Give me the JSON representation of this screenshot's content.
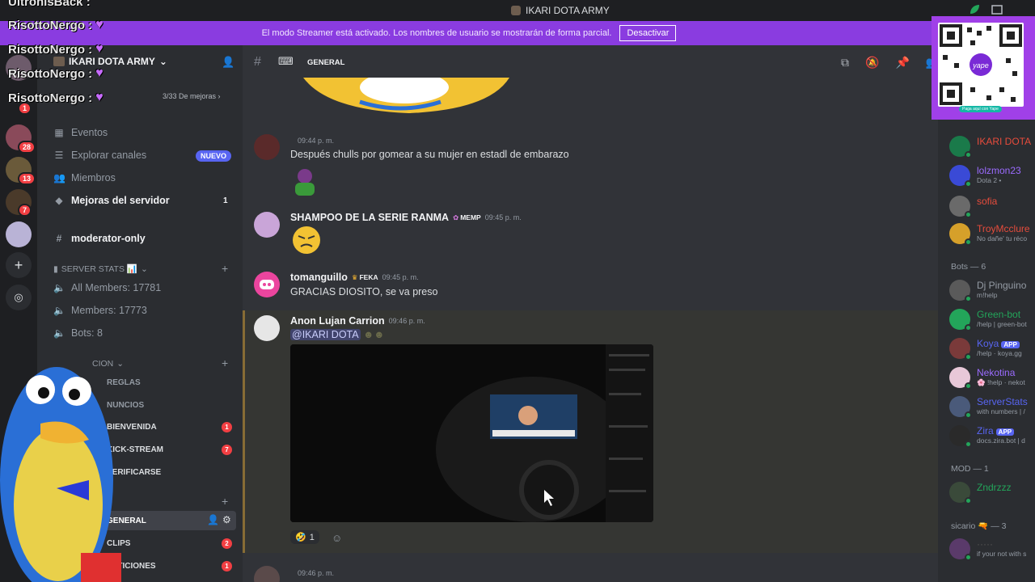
{
  "window": {
    "server_title": "IKARI DOTA ARMY"
  },
  "banner": {
    "text": "El modo Streamer está activado. Los nombres de usuario se mostrarán de forma parcial.",
    "button": "Desactivar"
  },
  "overlay_chat": [
    {
      "name": "UltronisBack :"
    },
    {
      "name": "RisottoNergo :"
    },
    {
      "name": "RisottoNergo :"
    },
    {
      "name": "RisottoNergo :"
    },
    {
      "name": "RisottoNergo :"
    }
  ],
  "rail": {
    "badges": [
      "1",
      "28",
      "13",
      "7"
    ]
  },
  "sidebar": {
    "server_name": "IKARI DOTA ARMY",
    "boost_progress": "3/33 De mejoras",
    "items": [
      {
        "label": "Eventos"
      },
      {
        "label": "Explorar canales",
        "badge": "NUEVO"
      },
      {
        "label": "Miembros"
      },
      {
        "label": "Mejoras del servidor",
        "count": "1"
      },
      {
        "label": "moderator-only"
      }
    ],
    "stats_category": "SERVER STATS 📊",
    "stats": [
      "All Members: 17781",
      "Members: 17773",
      "Bots: 8"
    ],
    "category2": "CION",
    "channels": [
      {
        "label": "REGLAS"
      },
      {
        "label": "NUNCIOS"
      },
      {
        "label": "BIENVENIDA",
        "badge": "1"
      },
      {
        "label": "KICK-STREAM",
        "badge": "7"
      },
      {
        "label": "VERIFICARSE"
      },
      {
        "label": "GENERAL"
      },
      {
        "label": "CLIPS",
        "badge": "2"
      },
      {
        "label": "PETICIONES",
        "badge": "1"
      }
    ]
  },
  "channel": {
    "name": "GENERAL",
    "emoji": "⌨"
  },
  "messages": [
    {
      "time": "09:44 p. m.",
      "text": "Después chulls por gomear a su mujer en estadl de embarazo"
    },
    {
      "author": "SHAMPOO DE LA SERIE RANMA",
      "tag": "MEMP",
      "time": "09:45 p. m."
    },
    {
      "author": "tomanguillo",
      "tag": "FEKA",
      "time": "09:45 p. m.",
      "text": "GRACIAS DIOSITO, se va preso"
    },
    {
      "author": "Anon Lujan Carrion",
      "time": "09:46 p. m.",
      "mention": "@IKARI DOTA",
      "reaction_count": "1"
    },
    {
      "time": "09:46 p. m."
    }
  ],
  "members": {
    "online": [
      {
        "name": "IKARI DOTA",
        "color": "#e74c3c"
      },
      {
        "name": "lolzmon23",
        "sub": "Dota 2 •",
        "color": "#9b6bff"
      },
      {
        "name": "sofia",
        "color": "#e74c3c"
      },
      {
        "name": "TroyMcclure",
        "sub": "No dañe' tu réco",
        "color": "#e74c3c"
      }
    ],
    "bots_header": "Bots — 6",
    "bots": [
      {
        "name": "Dj Pinguino",
        "sub": "m!help",
        "color": "#949ba4"
      },
      {
        "name": "Green-bot",
        "sub": "/help | green-bot",
        "color": "#23a55a"
      },
      {
        "name": "Koya",
        "tag": "APP",
        "sub": "/help · koya.gg",
        "color": "#5865f2"
      },
      {
        "name": "Nekotina",
        "sub": "🌸 !help · nekot",
        "color": "#9b6bff"
      },
      {
        "name": "ServerStats",
        "sub": "with numbers | /",
        "color": "#5865f2"
      },
      {
        "name": "Zira",
        "tag": "APP",
        "sub": "docs.zira.bot | d",
        "color": "#5865f2"
      }
    ],
    "mod_header": "MOD — 1",
    "mods": [
      {
        "name": "Zndrzzz",
        "color": "#23a55a"
      }
    ],
    "sicario_header": "sicario 🔫 — 3",
    "sicario_sub": "if your not with s"
  },
  "qr": {
    "caption": "Paga aquí con Yape"
  }
}
